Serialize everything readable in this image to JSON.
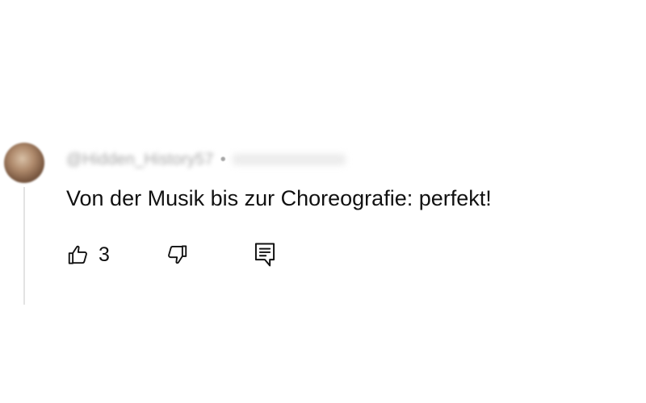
{
  "comment": {
    "username": "@Hidden_History57",
    "separator": "•",
    "text": "Von der Musik bis zur Choreografie: perfekt!",
    "like_count": "3"
  },
  "icons": {
    "avatar": "avatar",
    "like": "thumbs-up-icon",
    "dislike": "thumbs-down-icon",
    "reply": "reply-icon"
  },
  "colors": {
    "text": "#111111",
    "muted": "#a6a6a6",
    "thread_line": "#e3e3e3"
  }
}
